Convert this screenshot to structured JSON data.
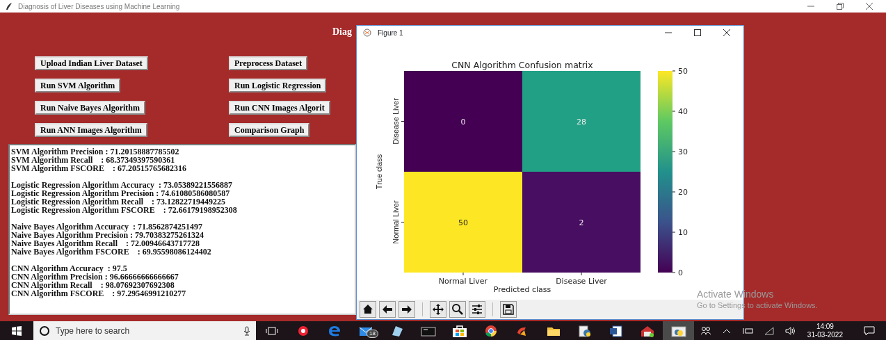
{
  "window": {
    "title": "Diagnosis of Liver Diseases using Machine Learning"
  },
  "heading": "Diag",
  "buttons": [
    {
      "label": "Upload Indian Liver Dataset"
    },
    {
      "label": "Preprocess Dataset"
    },
    {
      "label": "Run SVM Algorithm"
    },
    {
      "label": "Run Logistic Regression"
    },
    {
      "label": "Run Naive Bayes Algorithm"
    },
    {
      "label": "Run CNN Images Algorit"
    },
    {
      "label": "Run ANN Images Algorithm"
    },
    {
      "label": "Comparison Graph"
    }
  ],
  "output": [
    [
      "SVM Algorithm Precision : 71.20158887785502",
      "SVM Algorithm Recall    : 68.37349397590361",
      "SVM Algorithm FSCORE    : 67.20515765682316"
    ],
    [
      "Logistic Regression Algorithm Accuracy  : 73.05389221556887",
      "Logistic Regression Algorithm Precision : 74.61080586080587",
      "Logistic Regression Algorithm Recall    : 73.12822719449225",
      "Logistic Regression Algorithm FSCORE    : 72.66179198952308"
    ],
    [
      "Naive Bayes Algorithm Accuracy  : 71.8562874251497",
      "Naive Bayes Algorithm Precision : 79.70383275261324",
      "Naive Bayes Algorithm Recall    : 72.00946643717728",
      "Naive Bayes Algorithm FSCORE    : 69.95598086124402"
    ],
    [
      "CNN Algorithm Accuracy  : 97.5",
      "CNN Algorithm Precision : 96.66666666666667",
      "CNN Algorithm Recall    : 98.07692307692308",
      "CNN Algorithm FSCORE    : 97.29546991210277"
    ]
  ],
  "figure": {
    "title": "Figure 1",
    "heatmap": {
      "title": "CNN Algorithm Confusion matrix",
      "xlabel": "Predicted class",
      "ylabel": "True class",
      "columns": [
        "Normal Liver",
        "Disease Liver"
      ],
      "rows": [
        "Disease Liver",
        "Normal Liver"
      ],
      "cells": [
        [
          {
            "value": "0",
            "color": "#440154"
          },
          {
            "value": "28",
            "color": "#21a085"
          }
        ],
        [
          {
            "value": "50",
            "color": "#fde725"
          },
          {
            "value": "2",
            "color": "#470e61"
          }
        ]
      ],
      "colorbar_ticks": [
        "50",
        "40",
        "30",
        "20",
        "10",
        "0"
      ]
    }
  },
  "activation": {
    "title": "Activate Windows",
    "subtitle": "Go to Settings to activate Windows."
  },
  "taskbar": {
    "search_placeholder": "Type here to search",
    "apps": [
      {
        "selected": false
      },
      {
        "selected": false
      },
      {
        "selected": false,
        "badge": "18"
      },
      {
        "selected": false
      },
      {
        "selected": false
      },
      {
        "selected": false
      },
      {
        "selected": false
      },
      {
        "selected": false
      },
      {
        "selected": false
      },
      {
        "selected": false
      },
      {
        "selected": false
      },
      {
        "selected": false
      },
      {
        "selected": true
      }
    ],
    "time": "14:09",
    "date": "31-03-2022"
  }
}
